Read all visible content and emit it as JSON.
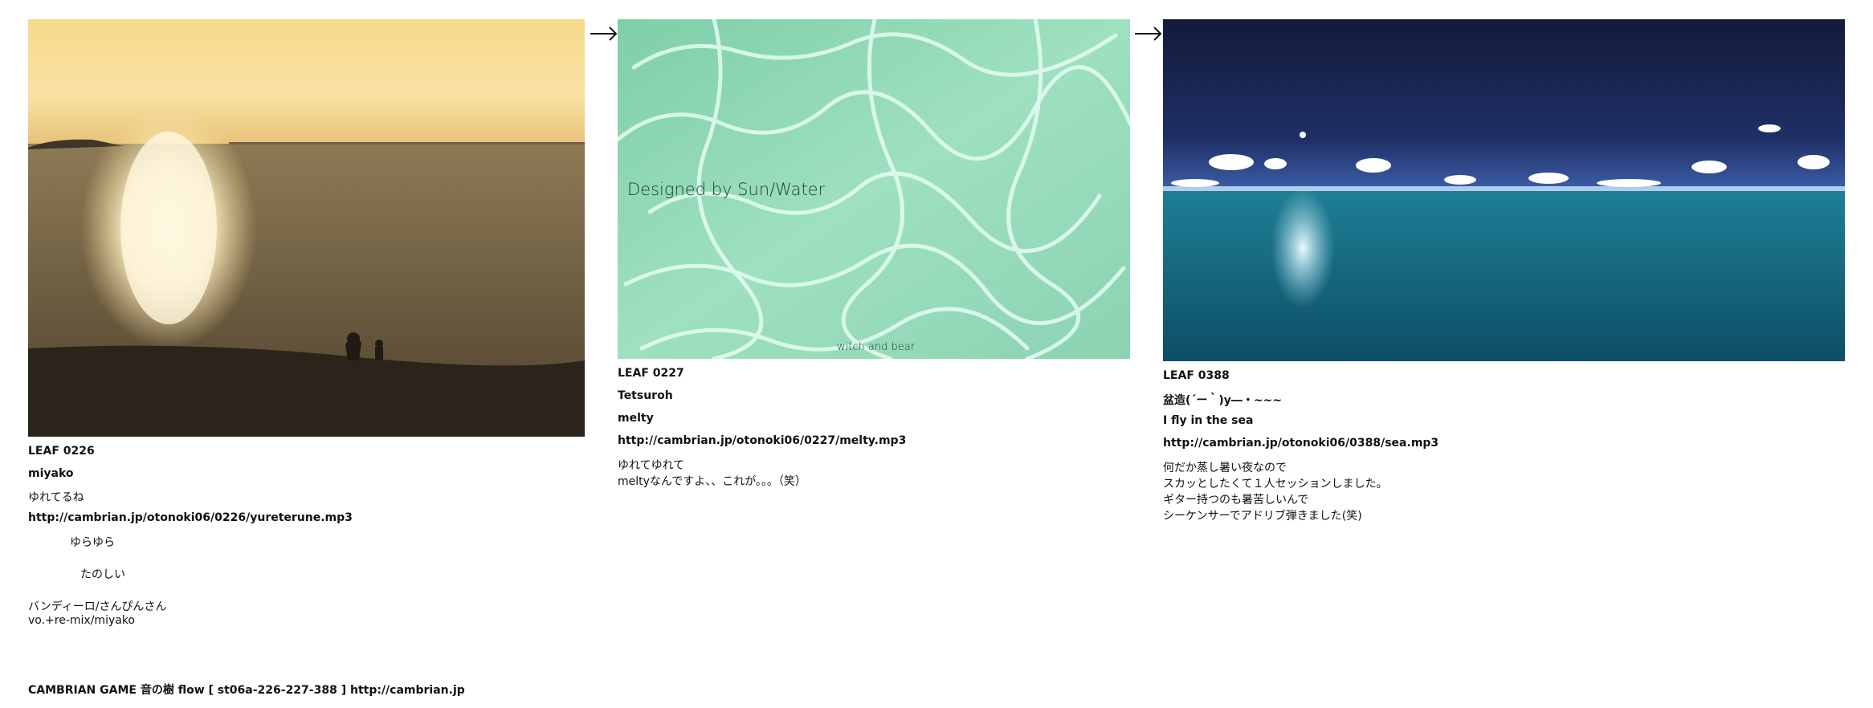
{
  "leaves": [
    {
      "id": "LEAF 0226",
      "artist": "miyako",
      "title": "ゆれてるね",
      "url": "http://cambrian.jp/otonoki06/0226/yureterune.mp3",
      "notes": [
        "ゆらゆら",
        "たのしい",
        "バンディーロ/さんぴんさん",
        "vo.+re-mix/miyako"
      ]
    },
    {
      "id": "LEAF 0227",
      "artist": "Tetsuroh",
      "title": "melty",
      "url": "http://cambrian.jp/otonoki06/0227/melty.mp3",
      "notes": [
        "ゆれてゆれて",
        "meltyなんですよ、、これが。。。（笑）"
      ],
      "image_caption": "Designed by Sun/Water",
      "image_credit": "witch and bear"
    },
    {
      "id": "LEAF 0388",
      "artist": "盆造(´ー｀)y―・~~~",
      "title": "I fly in the sea",
      "url": "http://cambrian.jp/otonoki06/0388/sea.mp3",
      "notes": [
        "何だか蒸し暑い夜なので",
        "スカッとしたくて１人セッションしました。",
        "ギター持つのも暑苦しいんで",
        "シーケンサーでアドリブ弾きました(笑)"
      ]
    }
  ],
  "footer": "CAMBRIAN GAME  音の樹  flow [ st06a-226-227-388 ]    http://cambrian.jp",
  "icons": {
    "flow_arrow": "right-arrow-icon"
  },
  "colors": {
    "text": "#111111",
    "background": "#ffffff"
  }
}
